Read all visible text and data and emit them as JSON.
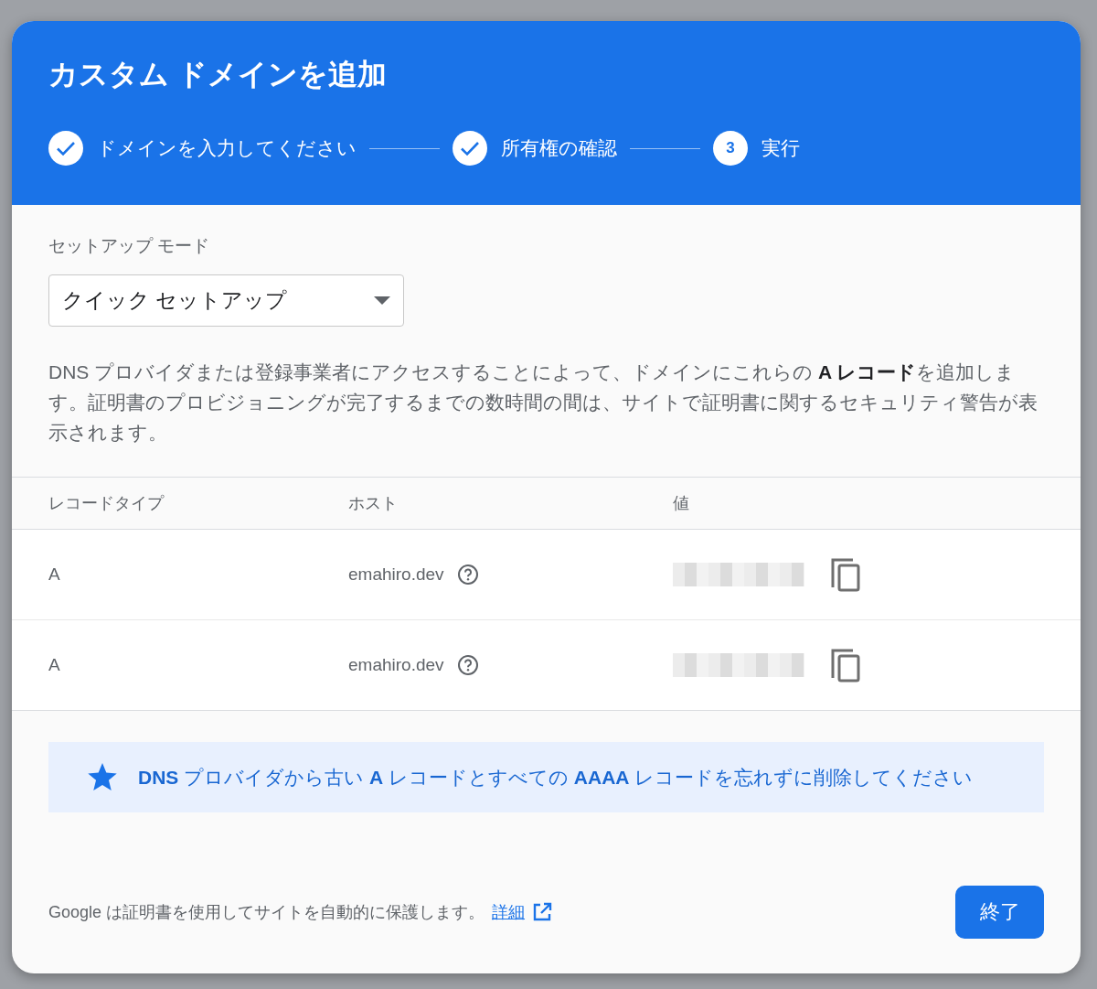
{
  "dialog": {
    "title": "カスタム ドメインを追加",
    "steps": [
      {
        "label": "ドメインを入力してください",
        "completed": true
      },
      {
        "label": "所有権の確認",
        "completed": true
      },
      {
        "number": "3",
        "label": "実行",
        "completed": false
      }
    ],
    "setup_mode": {
      "label": "セットアップ モード",
      "value": "クイック セットアップ"
    },
    "description": "DNS プロバイダまたは登録事業者にアクセスすることによって、ドメインにこれらの **A レコード**を追加します。証明書のプロビジョニングが完了するまでの数時間の間は、サイトで証明書に関するセキュリティ警告が表示されます。",
    "table": {
      "columns": [
        "レコードタイプ",
        "ホスト",
        "値"
      ],
      "rows": [
        {
          "type": "A",
          "host": "emahiro.dev",
          "value_redacted": true
        },
        {
          "type": "A",
          "host": "emahiro.dev",
          "value_redacted": true
        }
      ]
    },
    "notice": "**DNS** プロバイダから古い **A** レコードとすべての **AAAA** レコードを忘れずに削除してください",
    "footer": {
      "text": "Google は証明書を使用してサイトを自動的に保護します。",
      "link": "詳細",
      "button": "終了"
    }
  }
}
